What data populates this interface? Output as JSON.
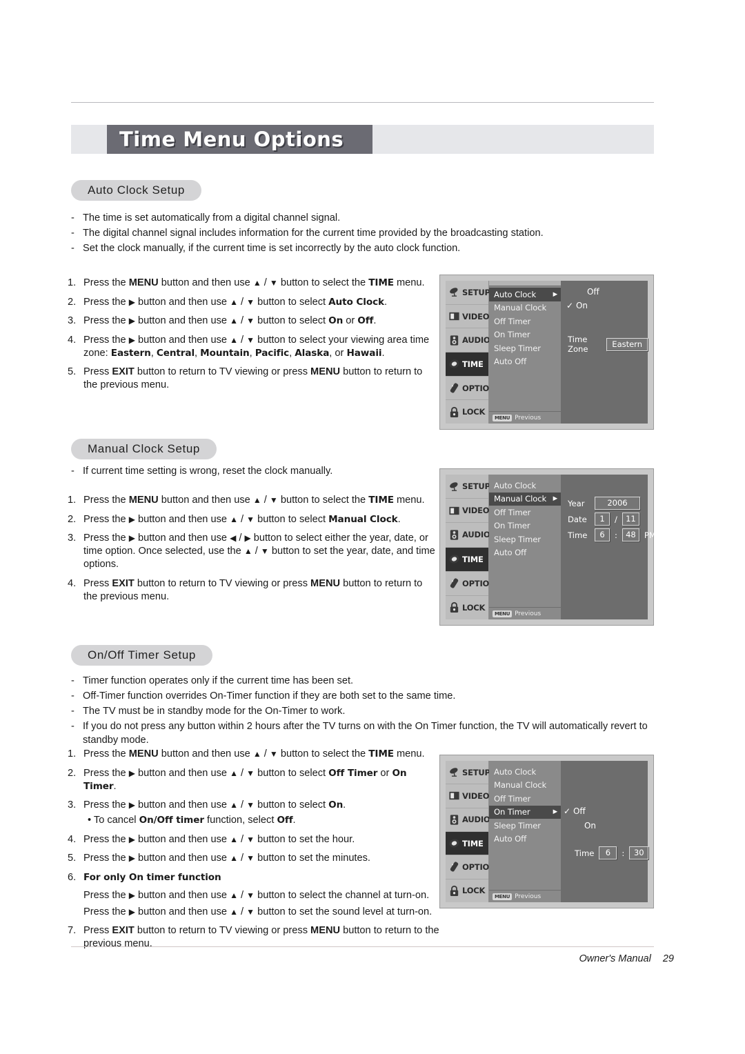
{
  "page": {
    "title": "Time Menu Options",
    "footer_label": "Owner's Manual",
    "footer_page": "29"
  },
  "sections": {
    "auto_clock": {
      "heading": "Auto Clock Setup",
      "bullets": [
        "The time is set automatically from a digital channel signal.",
        "The digital channel signal includes information for the current time provided by the broadcasting station.",
        "Set the clock manually, if the current time is set incorrectly by the auto clock function."
      ],
      "steps": [
        {
          "n": "1.",
          "html": "Press the <b>MENU</b> button and then use <span class='arrow'>▲</span> / <span class='arrow'>▼</span> button to select the <span class='bb'>TIME</span> menu."
        },
        {
          "n": "2.",
          "html": "Press the <span class='arrow'>▶</span> button and then use <span class='arrow'>▲</span> / <span class='arrow'>▼</span> button to select <span class='bb'>Auto Clock</span>."
        },
        {
          "n": "3.",
          "html": "Press the <span class='arrow'>▶</span> button and then use <span class='arrow'>▲</span> / <span class='arrow'>▼</span> button to select <span class='bb'>On</span> or <span class='bb'>Off</span>."
        },
        {
          "n": "4.",
          "html": "Press the <span class='arrow'>▶</span> button and then use <span class='arrow'>▲</span> / <span class='arrow'>▼</span> button to select your viewing area time zone: <span class='bb'>Eastern</span>, <span class='bb'>Central</span>, <span class='bb'>Mountain</span>, <span class='bb'>Pacific</span>, <span class='bb'>Alaska</span>, or <span class='bb'>Hawaii</span>."
        },
        {
          "n": "5.",
          "html": "Press <b>EXIT</b> button to return to TV viewing or press <b>MENU</b> button to return to the previous menu."
        }
      ]
    },
    "manual_clock": {
      "heading": "Manual Clock Setup",
      "bullets": [
        "If current time setting is wrong, reset the clock manually."
      ],
      "steps": [
        {
          "n": "1.",
          "html": "Press the <b>MENU</b> button and then use <span class='arrow'>▲</span> / <span class='arrow'>▼</span> button to select the <span class='bb'>TIME</span> menu."
        },
        {
          "n": "2.",
          "html": "Press the <span class='arrow'>▶</span> button and then use <span class='arrow'>▲</span> / <span class='arrow'>▼</span> button to select <span class='bb'>Manual Clock</span>."
        },
        {
          "n": "3.",
          "html": "Press the <span class='arrow'>▶</span> button and then use <span class='arrow'>◀</span> / <span class='arrow'>▶</span> button to select either the year, date, or time option. Once selected, use the <span class='arrow'>▲</span> / <span class='arrow'>▼</span> button to set the year, date, and time options."
        },
        {
          "n": "4.",
          "html": "Press <b>EXIT</b> button to return to TV viewing or press <b>MENU</b> button to return to the previous menu."
        }
      ]
    },
    "onoff_timer": {
      "heading": "On/Off Timer Setup",
      "bullets": [
        "Timer function operates only if the current time has been set.",
        "Off-Timer function overrides On-Timer function if they are both set to the same time.",
        "The TV must be in standby mode for the On-Timer to work.",
        "If you do not press any button within 2 hours after the TV turns on with the On Timer function, the TV will automatically revert to standby mode."
      ],
      "steps": [
        {
          "n": "1.",
          "html": "Press the <b>MENU</b> button and then use <span class='arrow'>▲</span> / <span class='arrow'>▼</span> button to select the <span class='bb'>TIME</span> menu."
        },
        {
          "n": "2.",
          "html": "Press the <span class='arrow'>▶</span> button and then use <span class='arrow'>▲</span> / <span class='arrow'>▼</span> button to select <span class='bb'>Off Timer</span> or <span class='bb'>On Timer</span>."
        },
        {
          "n": "3.",
          "html": "Press the <span class='arrow'>▶</span> button and then use <span class='arrow'>▲</span> / <span class='arrow'>▼</span> button to select <span class='bb'>On</span>.<div class='sub'>• To cancel <span class='bb'>On/Off timer</span> function, select <span class='bb'>Off</span>.</div>"
        },
        {
          "n": "4.",
          "html": "Press the <span class='arrow'>▶</span> button and then use <span class='arrow'>▲</span> / <span class='arrow'>▼</span> button to set the hour."
        },
        {
          "n": "5.",
          "html": "Press the <span class='arrow'>▶</span> button and then use <span class='arrow'>▲</span> / <span class='arrow'>▼</span> button to set the minutes."
        },
        {
          "n": "6.",
          "html": "<span class='bb'>For only On timer function</span><div style='margin-top:7px'>Press the <span class='arrow'>▶</span> button and then use <span class='arrow'>▲</span> / <span class='arrow'>▼</span> button to select the channel at turn-on.</div><div style='margin-top:5px'>Press the <span class='arrow'>▶</span> button and then use <span class='arrow'>▲</span> / <span class='arrow'>▼</span> button to set the sound level at turn-on.</div>"
        },
        {
          "n": "7.",
          "html": "Press <b>EXIT</b> button to return to TV viewing or press <b>MENU</b> button to return to the previous menu."
        }
      ]
    }
  },
  "osd_common": {
    "sidebar": [
      {
        "label": "SETUP",
        "icon": "satellite-dish-icon"
      },
      {
        "label": "VIDEO",
        "icon": "monitor-icon"
      },
      {
        "label": "AUDIO",
        "icon": "speaker-icon"
      },
      {
        "label": "TIME",
        "icon": "clock-icon"
      },
      {
        "label": "OPTION",
        "icon": "remote-icon"
      },
      {
        "label": "LOCK",
        "icon": "padlock-icon"
      }
    ],
    "active_sidebar": "TIME",
    "menu_items": [
      "Auto Clock",
      "Manual Clock",
      "Off Timer",
      "On Timer",
      "Sleep Timer",
      "Auto Off"
    ],
    "previous_chip": "MENU",
    "previous_label": "Previous"
  },
  "osd_panels": [
    {
      "id": "auto-clock-osd",
      "selected_item": "Auto Clock",
      "options": [
        {
          "label": "Off",
          "checked": false
        },
        {
          "label": "On",
          "checked": true
        }
      ],
      "fields": [
        {
          "label": "Time Zone",
          "value": "Eastern"
        }
      ]
    },
    {
      "id": "manual-clock-osd",
      "selected_item": "Manual Clock",
      "options": [],
      "fields": [
        {
          "label": "Year",
          "value": "2006"
        },
        {
          "label": "Date",
          "value": "1",
          "sep": "/",
          "value2": "11"
        },
        {
          "label": "Time",
          "value": "6",
          "sep": ":",
          "value2": "48",
          "suffix": "PM"
        }
      ]
    },
    {
      "id": "on-timer-osd",
      "selected_item": "On Timer",
      "options": [
        {
          "label": "Off",
          "checked": true
        },
        {
          "label": "On",
          "checked": false
        }
      ],
      "fields": [
        {
          "label": "Time",
          "value": "6",
          "sep": ":",
          "value2": "30"
        }
      ]
    }
  ],
  "colors": {
    "title_box": "#6b6b73",
    "title_strip": "#e6e7ea",
    "pill": "#d4d4d6",
    "osd_frame": "#c9c9c9",
    "osd_sidebar": "#bdbdbd",
    "osd_active": "#2f2f2f",
    "osd_mid": "#8a8a8a",
    "osd_right": "#6d6d6d"
  }
}
